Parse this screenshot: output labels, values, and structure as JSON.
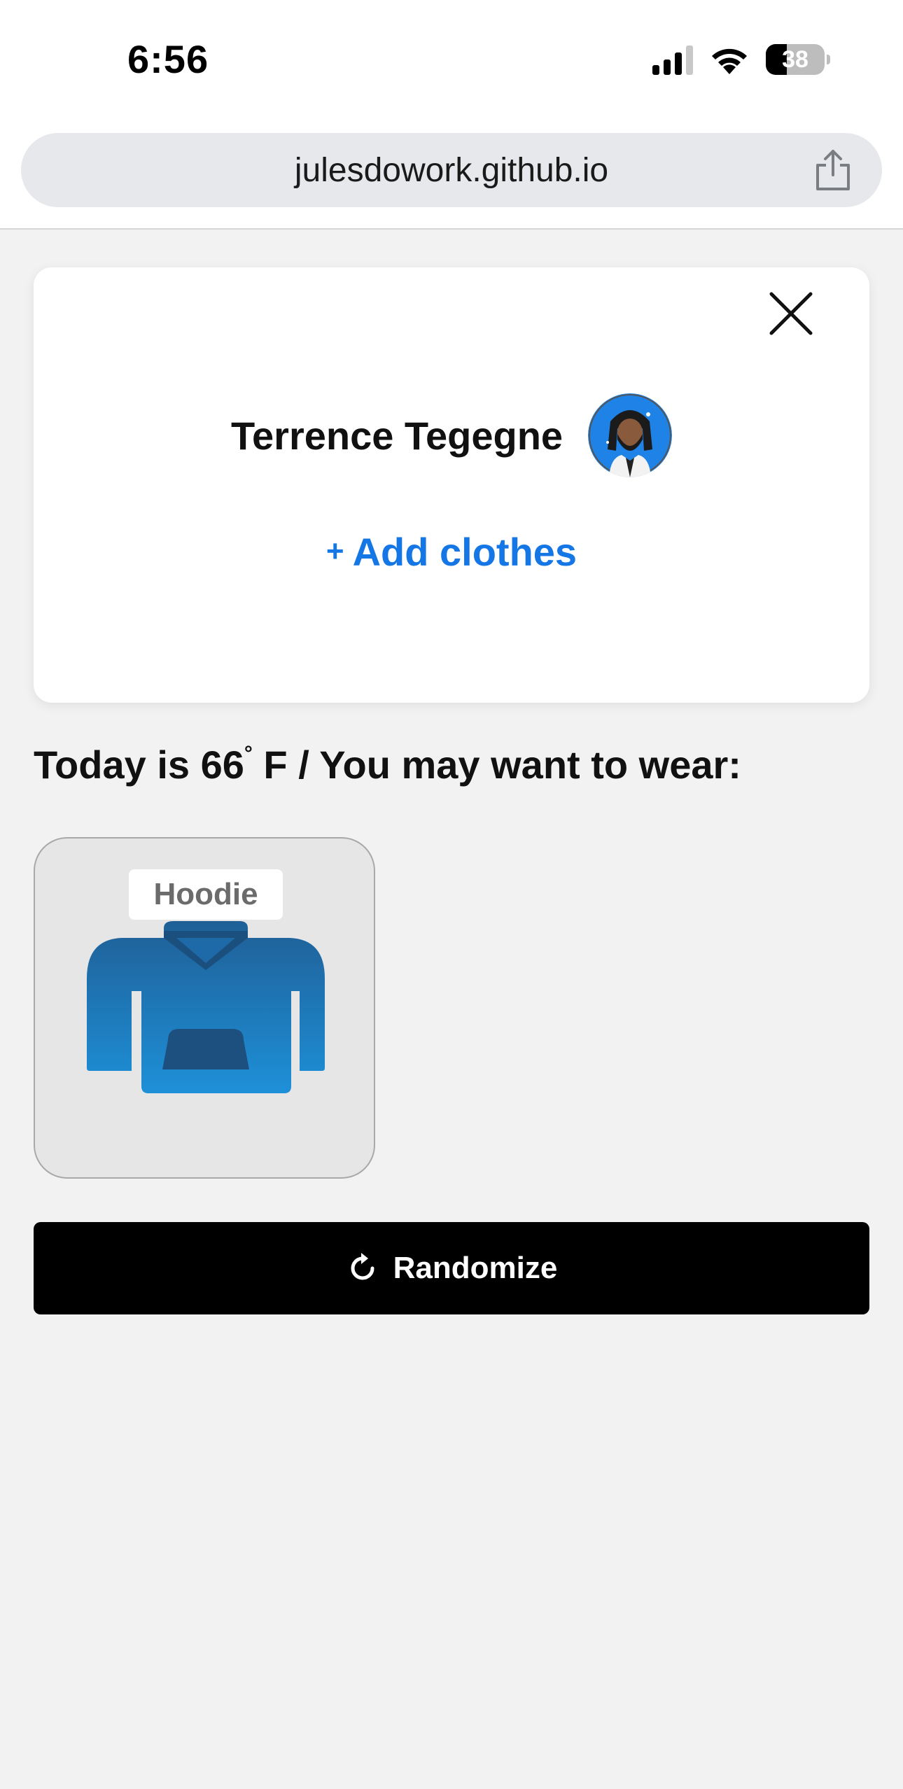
{
  "status_bar": {
    "time": "6:56",
    "battery": "38"
  },
  "browser": {
    "url": "julesdowork.github.io"
  },
  "profile": {
    "name": "Terrence Tegegne",
    "add_clothes_plus": "+",
    "add_clothes_label": "Add clothes"
  },
  "weather": {
    "prefix": "Today is 66",
    "degree": "°",
    "suffix": " F / You may want to wear:"
  },
  "suggestions": [
    {
      "label": "Hoodie",
      "icon": "hoodie-icon"
    }
  ],
  "actions": {
    "randomize_label": "Randomize"
  },
  "colors": {
    "accent": "#1577e6",
    "button_bg": "#000000",
    "hoodie_top": "#1f5f96",
    "hoodie_bottom": "#1e90d8"
  }
}
